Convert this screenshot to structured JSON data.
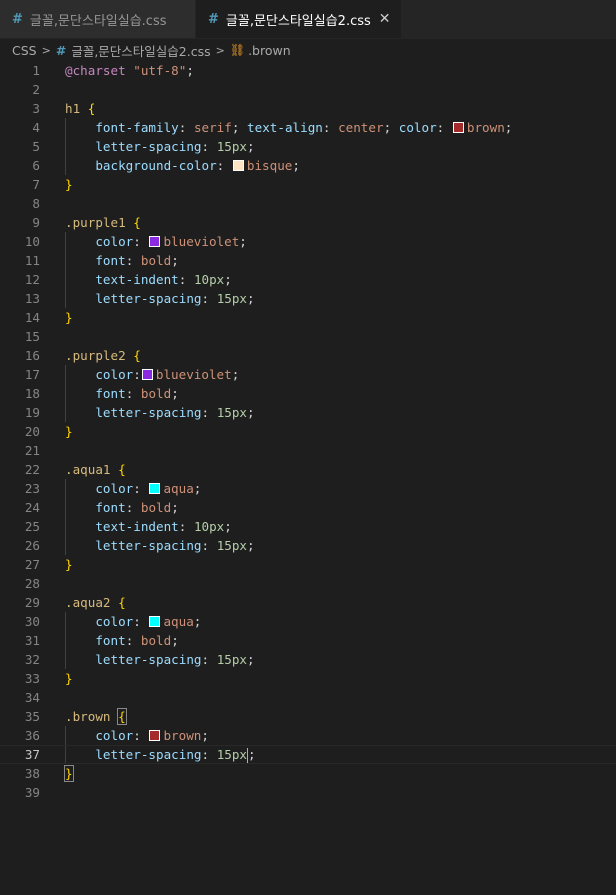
{
  "tabs": [
    {
      "label": "글꼴,문단스타일실습.css",
      "active": false
    },
    {
      "label": "글꼴,문단스타일실습2.css",
      "active": true,
      "close_glyph": "✕"
    }
  ],
  "breadcrumb": {
    "folder": "CSS",
    "file": "글꼴,문단스타일실습2.css",
    "symbol": ".brown"
  },
  "colors": {
    "brown": "#a52a2a",
    "bisque": "#ffe4c4",
    "blueviolet": "#8a2be2",
    "aqua": "#00ffff",
    "accent_css_icon": "#519aba"
  },
  "lines": [
    {
      "n": "1"
    },
    {
      "n": "2"
    },
    {
      "n": "3"
    },
    {
      "n": "4"
    },
    {
      "n": "5"
    },
    {
      "n": "6"
    },
    {
      "n": "7"
    },
    {
      "n": "8"
    },
    {
      "n": "9"
    },
    {
      "n": "10"
    },
    {
      "n": "11"
    },
    {
      "n": "12"
    },
    {
      "n": "13"
    },
    {
      "n": "14"
    },
    {
      "n": "15"
    },
    {
      "n": "16"
    },
    {
      "n": "17"
    },
    {
      "n": "18"
    },
    {
      "n": "19"
    },
    {
      "n": "20"
    },
    {
      "n": "21"
    },
    {
      "n": "22"
    },
    {
      "n": "23"
    },
    {
      "n": "24"
    },
    {
      "n": "25"
    },
    {
      "n": "26"
    },
    {
      "n": "27"
    },
    {
      "n": "28"
    },
    {
      "n": "29"
    },
    {
      "n": "30"
    },
    {
      "n": "31"
    },
    {
      "n": "32"
    },
    {
      "n": "33"
    },
    {
      "n": "34"
    },
    {
      "n": "35"
    },
    {
      "n": "36"
    },
    {
      "n": "37"
    },
    {
      "n": "38"
    },
    {
      "n": "39"
    }
  ],
  "code": {
    "charset_kw": "@charset",
    "charset_val": "\"utf-8\"",
    "semi": ";",
    "open": "{",
    "close": "}",
    "colon": ":",
    "h1_sel": "h1 ",
    "font_family": "font-family",
    "serif": "serif",
    "text_align": "text-align",
    "center": "center",
    "color": "color",
    "brown": "brown",
    "letter_spacing": "letter-spacing",
    "px15": "15px",
    "background_color": "background-color",
    "bisque": "bisque",
    "purple1_sel": ".purple1 ",
    "blueviolet": "blueviolet",
    "font": "font",
    "bold": "bold",
    "text_indent": "text-indent",
    "px10": "10px",
    "purple2_sel": ".purple2 ",
    "aqua1_sel": ".aqua1 ",
    "aqua": "aqua",
    "aqua2_sel": ".aqua2 ",
    "brown_sel": ".brown "
  }
}
